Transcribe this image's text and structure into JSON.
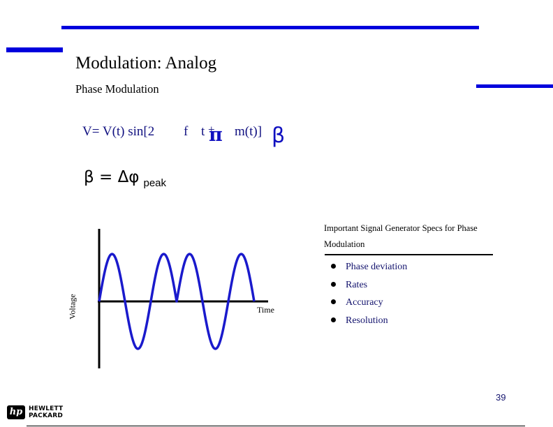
{
  "slide": {
    "title": "Modulation: Analog",
    "subtitle": "Phase Modulation",
    "page_number": "39",
    "accent_color": "#0000dd"
  },
  "formula": {
    "main": "V= V(t) sin[2",
    "f": "f",
    "t": "t",
    "plus": "+",
    "pi": "π",
    "m": "m(t)]",
    "beta": "β"
  },
  "beta_equation": {
    "main": "β = Δφ",
    "subscript": "peak"
  },
  "diagram": {
    "type": "waveform",
    "description": "Phase-modulated sine wave",
    "y_axis_label": "Voltage",
    "x_axis_label": "Time",
    "line_color": "#1a1acc",
    "segments": [
      {
        "kind": "half-cycle",
        "sign": 1
      },
      {
        "kind": "half-cycle",
        "sign": -1
      },
      {
        "kind": "half-cycle",
        "sign": 1
      },
      {
        "kind": "half-cycle",
        "sign": 1
      },
      {
        "kind": "half-cycle",
        "sign": -1
      },
      {
        "kind": "half-cycle",
        "sign": 1
      }
    ]
  },
  "specs": {
    "heading": "Important Signal Generator Specs for Phase Modulation",
    "items": [
      {
        "label": "Phase deviation"
      },
      {
        "label": "Rates"
      },
      {
        "label": "Accuracy"
      },
      {
        "label": "Resolution"
      }
    ]
  },
  "footer": {
    "logo_mark": "hp",
    "company_line1": "HEWLETT",
    "company_line2": "PACKARD"
  }
}
